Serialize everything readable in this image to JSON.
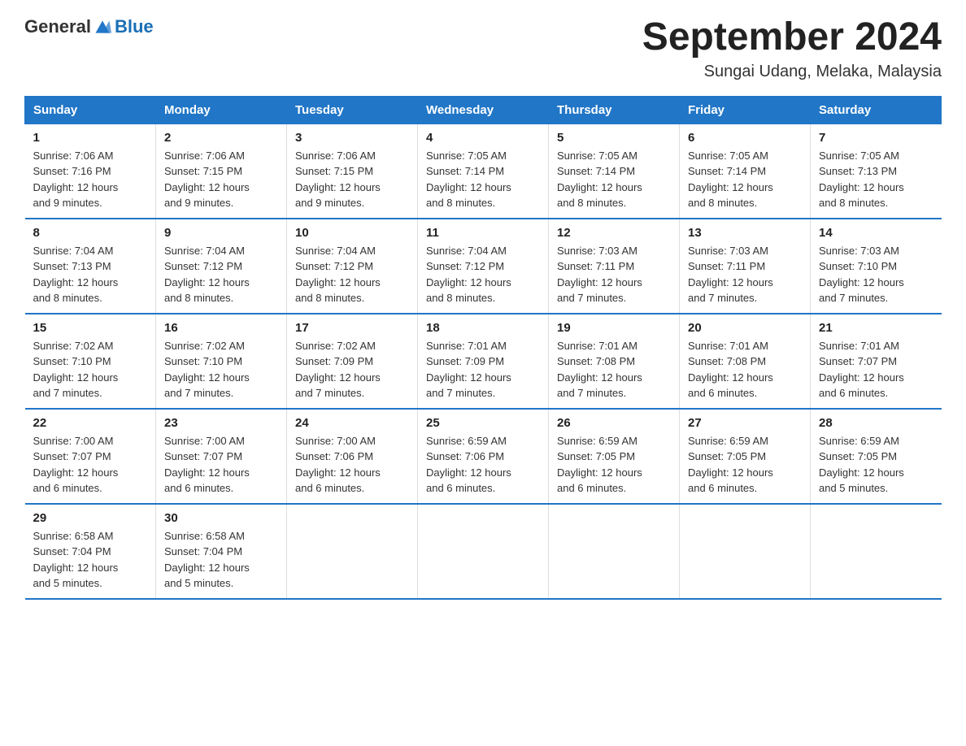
{
  "header": {
    "logo_general": "General",
    "logo_blue": "Blue",
    "title": "September 2024",
    "subtitle": "Sungai Udang, Melaka, Malaysia"
  },
  "columns": [
    "Sunday",
    "Monday",
    "Tuesday",
    "Wednesday",
    "Thursday",
    "Friday",
    "Saturday"
  ],
  "weeks": [
    [
      {
        "day": "1",
        "info": "Sunrise: 7:06 AM\nSunset: 7:16 PM\nDaylight: 12 hours\nand 9 minutes."
      },
      {
        "day": "2",
        "info": "Sunrise: 7:06 AM\nSunset: 7:15 PM\nDaylight: 12 hours\nand 9 minutes."
      },
      {
        "day": "3",
        "info": "Sunrise: 7:06 AM\nSunset: 7:15 PM\nDaylight: 12 hours\nand 9 minutes."
      },
      {
        "day": "4",
        "info": "Sunrise: 7:05 AM\nSunset: 7:14 PM\nDaylight: 12 hours\nand 8 minutes."
      },
      {
        "day": "5",
        "info": "Sunrise: 7:05 AM\nSunset: 7:14 PM\nDaylight: 12 hours\nand 8 minutes."
      },
      {
        "day": "6",
        "info": "Sunrise: 7:05 AM\nSunset: 7:14 PM\nDaylight: 12 hours\nand 8 minutes."
      },
      {
        "day": "7",
        "info": "Sunrise: 7:05 AM\nSunset: 7:13 PM\nDaylight: 12 hours\nand 8 minutes."
      }
    ],
    [
      {
        "day": "8",
        "info": "Sunrise: 7:04 AM\nSunset: 7:13 PM\nDaylight: 12 hours\nand 8 minutes."
      },
      {
        "day": "9",
        "info": "Sunrise: 7:04 AM\nSunset: 7:12 PM\nDaylight: 12 hours\nand 8 minutes."
      },
      {
        "day": "10",
        "info": "Sunrise: 7:04 AM\nSunset: 7:12 PM\nDaylight: 12 hours\nand 8 minutes."
      },
      {
        "day": "11",
        "info": "Sunrise: 7:04 AM\nSunset: 7:12 PM\nDaylight: 12 hours\nand 8 minutes."
      },
      {
        "day": "12",
        "info": "Sunrise: 7:03 AM\nSunset: 7:11 PM\nDaylight: 12 hours\nand 7 minutes."
      },
      {
        "day": "13",
        "info": "Sunrise: 7:03 AM\nSunset: 7:11 PM\nDaylight: 12 hours\nand 7 minutes."
      },
      {
        "day": "14",
        "info": "Sunrise: 7:03 AM\nSunset: 7:10 PM\nDaylight: 12 hours\nand 7 minutes."
      }
    ],
    [
      {
        "day": "15",
        "info": "Sunrise: 7:02 AM\nSunset: 7:10 PM\nDaylight: 12 hours\nand 7 minutes."
      },
      {
        "day": "16",
        "info": "Sunrise: 7:02 AM\nSunset: 7:10 PM\nDaylight: 12 hours\nand 7 minutes."
      },
      {
        "day": "17",
        "info": "Sunrise: 7:02 AM\nSunset: 7:09 PM\nDaylight: 12 hours\nand 7 minutes."
      },
      {
        "day": "18",
        "info": "Sunrise: 7:01 AM\nSunset: 7:09 PM\nDaylight: 12 hours\nand 7 minutes."
      },
      {
        "day": "19",
        "info": "Sunrise: 7:01 AM\nSunset: 7:08 PM\nDaylight: 12 hours\nand 7 minutes."
      },
      {
        "day": "20",
        "info": "Sunrise: 7:01 AM\nSunset: 7:08 PM\nDaylight: 12 hours\nand 6 minutes."
      },
      {
        "day": "21",
        "info": "Sunrise: 7:01 AM\nSunset: 7:07 PM\nDaylight: 12 hours\nand 6 minutes."
      }
    ],
    [
      {
        "day": "22",
        "info": "Sunrise: 7:00 AM\nSunset: 7:07 PM\nDaylight: 12 hours\nand 6 minutes."
      },
      {
        "day": "23",
        "info": "Sunrise: 7:00 AM\nSunset: 7:07 PM\nDaylight: 12 hours\nand 6 minutes."
      },
      {
        "day": "24",
        "info": "Sunrise: 7:00 AM\nSunset: 7:06 PM\nDaylight: 12 hours\nand 6 minutes."
      },
      {
        "day": "25",
        "info": "Sunrise: 6:59 AM\nSunset: 7:06 PM\nDaylight: 12 hours\nand 6 minutes."
      },
      {
        "day": "26",
        "info": "Sunrise: 6:59 AM\nSunset: 7:05 PM\nDaylight: 12 hours\nand 6 minutes."
      },
      {
        "day": "27",
        "info": "Sunrise: 6:59 AM\nSunset: 7:05 PM\nDaylight: 12 hours\nand 6 minutes."
      },
      {
        "day": "28",
        "info": "Sunrise: 6:59 AM\nSunset: 7:05 PM\nDaylight: 12 hours\nand 5 minutes."
      }
    ],
    [
      {
        "day": "29",
        "info": "Sunrise: 6:58 AM\nSunset: 7:04 PM\nDaylight: 12 hours\nand 5 minutes."
      },
      {
        "day": "30",
        "info": "Sunrise: 6:58 AM\nSunset: 7:04 PM\nDaylight: 12 hours\nand 5 minutes."
      },
      {
        "day": "",
        "info": ""
      },
      {
        "day": "",
        "info": ""
      },
      {
        "day": "",
        "info": ""
      },
      {
        "day": "",
        "info": ""
      },
      {
        "day": "",
        "info": ""
      }
    ]
  ]
}
